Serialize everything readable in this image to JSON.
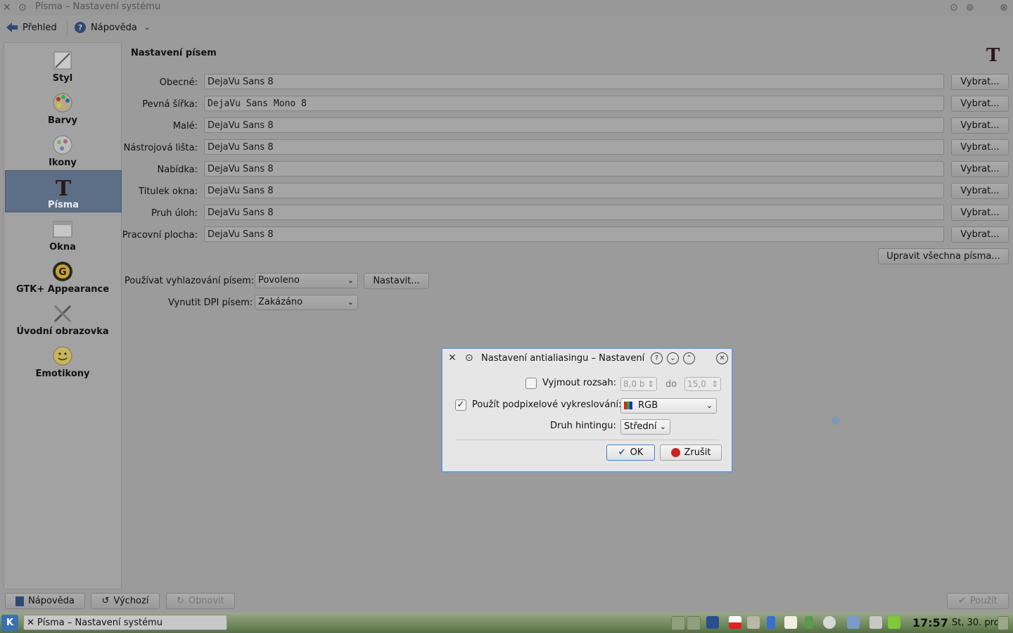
{
  "window": {
    "title": "Písma – Nastavení systému"
  },
  "toolbar": {
    "overview_label": "Přehled",
    "help_label": "Nápověda"
  },
  "sidebar": {
    "items": [
      {
        "label": "Styl",
        "icon": "style-icon"
      },
      {
        "label": "Barvy",
        "icon": "colors-icon"
      },
      {
        "label": "Ikony",
        "icon": "icons-icon"
      },
      {
        "label": "Písma",
        "icon": "fonts-icon",
        "active": true
      },
      {
        "label": "Okna",
        "icon": "windows-icon"
      },
      {
        "label": "GTK+ Appearance",
        "icon": "gtk-icon"
      },
      {
        "label": "Úvodní obrazovka",
        "icon": "splash-icon"
      },
      {
        "label": "Emotikony",
        "icon": "emoticons-icon"
      }
    ]
  },
  "main": {
    "title": "Nastavení písem",
    "choose_label": "Vybrat...",
    "font_rows": [
      {
        "label": "Obecné:",
        "value": "DejaVu Sans 8"
      },
      {
        "label": "Pevná šířka:",
        "value": "DejaVu Sans Mono 8"
      },
      {
        "label": "Malé:",
        "value": "DejaVu Sans 8"
      },
      {
        "label": "Nástrojová lišta:",
        "value": "DejaVu Sans 8"
      },
      {
        "label": "Nabídka:",
        "value": "DejaVu Sans 8"
      },
      {
        "label": "Titulek okna:",
        "value": "DejaVu Sans 8"
      },
      {
        "label": "Pruh úloh:",
        "value": "DejaVu Sans 8"
      },
      {
        "label": "Pracovní plocha:",
        "value": "DejaVu Sans 8"
      }
    ],
    "adjust_all_label": "Upravit všechna písma...",
    "antialias_label": "Používat vyhlazování písem:",
    "antialias_value": "Povoleno",
    "configure_label": "Nastavit...",
    "dpi_label": "Vynutit DPI písem:",
    "dpi_value": "Zakázáno"
  },
  "bottombar": {
    "help_label": "Nápověda",
    "defaults_label": "Výchozí",
    "reset_label": "Obnovit",
    "apply_label": "Použít"
  },
  "dialog": {
    "title": "Nastavení antialiasingu – Nastavení",
    "exclude_label": "Vyjmout rozsah:",
    "exclude_checked": false,
    "range_from": "8,0 b",
    "range_to_label": "do",
    "range_to": "15,0",
    "subpixel_label": "Použít podpixelové vykreslování:",
    "subpixel_checked": true,
    "subpixel_value": "RGB",
    "hinting_label": "Druh hintingu:",
    "hinting_value": "Střední",
    "ok_label": "OK",
    "cancel_label": "Zrušit"
  },
  "taskbar": {
    "task_label": "Písma – Nastavení systému",
    "time": "17:57",
    "date": "St, 30. pro"
  },
  "colors": {
    "accent": "#6f9ad6",
    "active_item": "#5d6f86"
  }
}
